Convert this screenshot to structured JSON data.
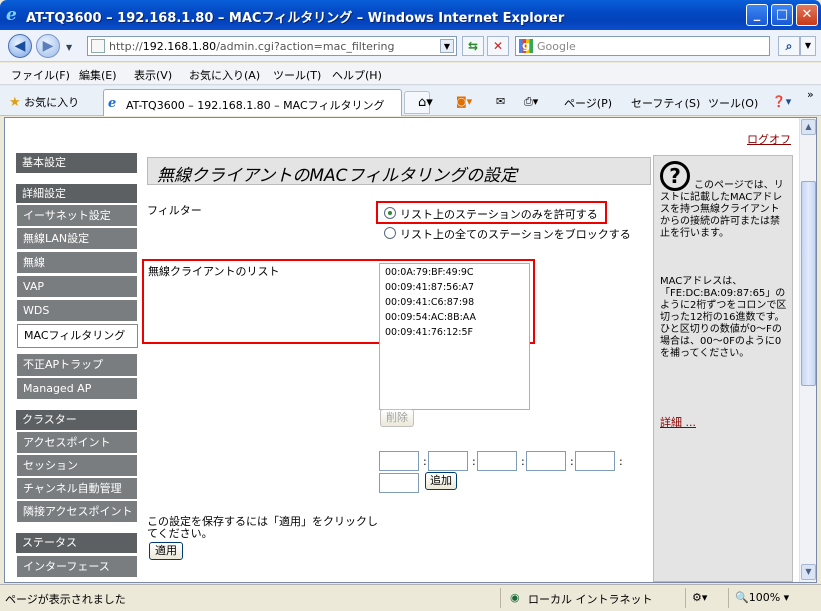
{
  "window": {
    "title": "AT-TQ3600 – 192.168.1.80 – MACフィルタリング – Windows Internet Explorer",
    "min": "_",
    "max": "□",
    "close": "✕"
  },
  "address": {
    "url_prefix": "http://",
    "url_host": "192.168.1.80",
    "url_path": "/admin.cgi?action=mac_filtering",
    "search_placeholder": "Google",
    "search_logo": "g"
  },
  "menu": [
    "ファイル(F)",
    "編集(E)",
    "表示(V)",
    "お気に入り(A)",
    "ツール(T)",
    "ヘルプ(H)"
  ],
  "tabs": {
    "favorites_label": "お気に入り",
    "active_tab": "AT-TQ3600 – 192.168.1.80 – MACフィルタリング",
    "tools": [
      "ページ(P)",
      "セーフティ(S)",
      "ツール(O)"
    ],
    "overflow": "»"
  },
  "page": {
    "logout": "ログオフ",
    "title": "無線クライアントのMACフィルタリングの設定",
    "filter_label": "フィルター",
    "radio_allow": "リスト上のステーションのみを許可する",
    "radio_block": "リスト上の全てのステーションをブロックする",
    "list_label": "無線クライアントのリスト",
    "macs": [
      "00:0A:79:BF:49:9C",
      "00:09:41:87:56:A7",
      "00:09:41:C6:87:98",
      "00:09:54:AC:8B:AA",
      "00:09:41:76:12:5F"
    ],
    "delete_btn": "削除",
    "add_btn": "追加",
    "save_note_1": "この設定を保存するには「適用」をクリックし",
    "save_note_2": "てください。",
    "apply_btn": "適用"
  },
  "nav": {
    "basic": "基本設定",
    "advanced": "詳細設定",
    "ethernet": "イーサネット設定",
    "wlan": "無線LAN設定",
    "wireless": "無線",
    "vap": "VAP",
    "wds": "WDS",
    "mac_filter": "MACフィルタリング",
    "rogue_ap": "不正APトラップ",
    "managed_ap": "Managed AP",
    "cluster": "クラスター",
    "access_points": "アクセスポイント",
    "sessions": "セッション",
    "channel": "チャンネル自動管理",
    "neighbor": "隣接アクセスポイント",
    "status": "ステータス",
    "interfaces": "インターフェース"
  },
  "help": {
    "text1": "このページでは、リストに記載したMACアドレスを持つ無線クライアントからの接続の許可または禁止を行います。",
    "text2": "MACアドレスは、「FE:DC:BA:09:87:65」のように2桁ずつをコロンで区切った12桁の16進数です。ひと区切りの数値が0～Fの場合は、00～0Fのように0を補ってください。",
    "more": "詳細 ..."
  },
  "status": {
    "left": "ページが表示されました",
    "zone": "ローカル イントラネット",
    "zoom": "100%"
  }
}
